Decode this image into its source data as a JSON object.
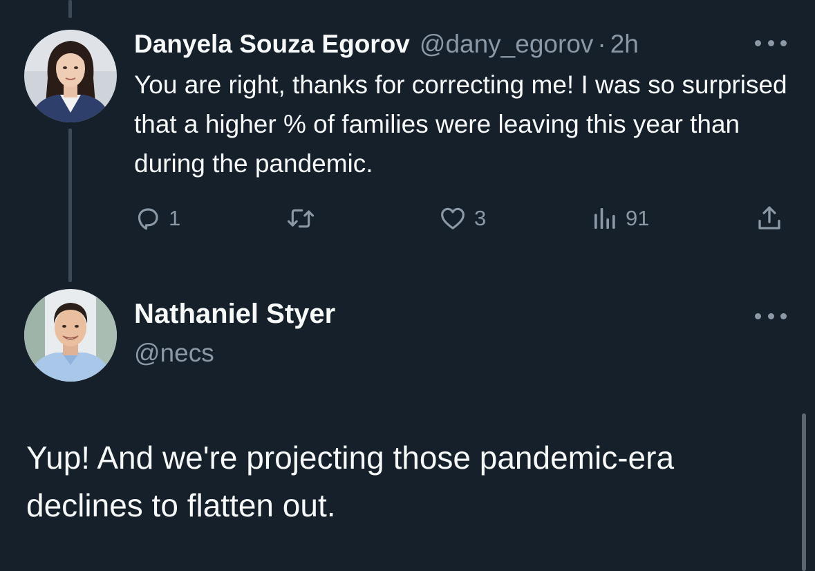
{
  "tweet1": {
    "author_name": "Danyela Souza Egorov",
    "handle": "@dany_egorov",
    "separator": "·",
    "time": "2h",
    "text": "You are right, thanks for correcting me! I was so surprised that a higher % of families were leaving this year than during the pandemic.",
    "replies": "1",
    "retweets": "",
    "likes": "3",
    "views": "91"
  },
  "tweet2": {
    "author_name": "Nathaniel Styer",
    "handle": "@necs",
    "text": "Yup! And we're projecting those pandemic-era declines to flatten out."
  },
  "icons": {
    "reply": "reply-icon",
    "retweet": "retweet-icon",
    "like": "heart-icon",
    "views": "views-icon",
    "share": "share-icon",
    "more": "more-horizontal-icon"
  },
  "colors": {
    "background": "#15202b",
    "primary_text": "#f7f9f9",
    "secondary_text": "#8b98a5",
    "thread_line": "#3d4a57"
  }
}
